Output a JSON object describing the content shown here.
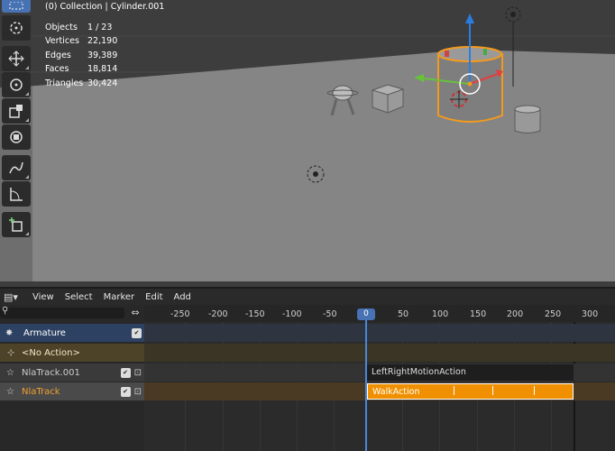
{
  "viewport": {
    "title": "(0) Collection | Cylinder.001",
    "stats": [
      {
        "label": "Objects",
        "value": "1 / 23"
      },
      {
        "label": "Vertices",
        "value": "22,190"
      },
      {
        "label": "Edges",
        "value": "39,389"
      },
      {
        "label": "Faces",
        "value": "18,814"
      },
      {
        "label": "Triangles",
        "value": "30,424"
      }
    ],
    "tools": [
      "select-box-icon",
      "cursor-icon",
      "move-icon",
      "rotate-icon",
      "scale-icon",
      "transform-icon",
      "annotate-icon",
      "measure-icon",
      "add-cube-icon"
    ]
  },
  "nla": {
    "menu": [
      "View",
      "Select",
      "Marker",
      "Edit",
      "Add"
    ],
    "ticks": [
      "-250",
      "-200",
      "-150",
      "-100",
      "-50",
      "0",
      "50",
      "100",
      "150",
      "200",
      "250",
      "300"
    ],
    "current_frame": "0",
    "channels": {
      "armature": "Armature",
      "no_action": "<No Action>",
      "track1": "NlaTrack.001",
      "track2": "NlaTrack"
    },
    "strips": {
      "strip1": "LeftRightMotionAction",
      "strip2": "WalkAction"
    },
    "colors": {
      "accent": "#4772b3",
      "strip_active": "#f09000",
      "no_action_bg": "#3b3526"
    }
  }
}
